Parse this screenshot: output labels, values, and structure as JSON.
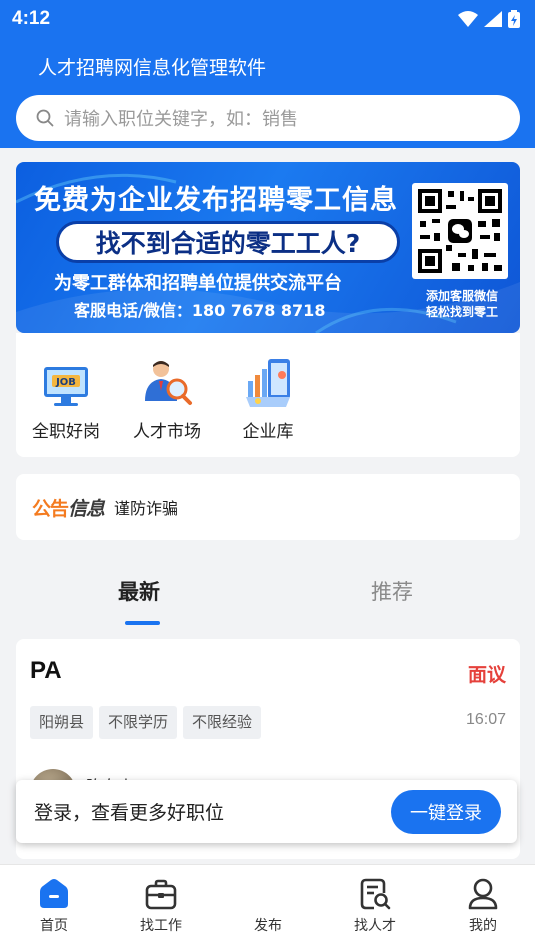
{
  "status": {
    "time": "4:12"
  },
  "header": {
    "title": "人才招聘网信息化管理软件"
  },
  "search": {
    "placeholder": "请输入职位关键字，如：销售"
  },
  "banner": {
    "line1": "免费为企业发布招聘零工信息",
    "line2": "找不到合适的零工工人?",
    "line3": "为零工群体和招聘单位提供交流平台",
    "line4": "客服电话/微信：180 7678 8718",
    "qr_caption_1": "添加客服微信",
    "qr_caption_2": "轻松找到零工"
  },
  "quick_links": [
    {
      "label": "全职好岗",
      "icon": "job-monitor-icon"
    },
    {
      "label": "人才市场",
      "icon": "talent-search-icon"
    },
    {
      "label": "企业库",
      "icon": "company-library-icon"
    }
  ],
  "notice": {
    "logo_part1": "公告",
    "logo_part2": "信息",
    "text": "谨防诈骗"
  },
  "tabs": {
    "latest": "最新",
    "recommend": "推荐"
  },
  "job": {
    "title": "PA",
    "salary": "面议",
    "tags": [
      "阳朔县",
      "不限学历",
      "不限经验"
    ],
    "time": "16:07",
    "poster": "陈女士"
  },
  "login_prompt": {
    "text": "登录，查看更多好职位",
    "button": "一键登录"
  },
  "tabbar": [
    {
      "label": "首页",
      "icon": "home-icon",
      "active": true
    },
    {
      "label": "找工作",
      "icon": "briefcase-icon",
      "active": false
    },
    {
      "label": "发布",
      "icon": "publish-icon",
      "active": false
    },
    {
      "label": "找人才",
      "icon": "find-talent-icon",
      "active": false
    },
    {
      "label": "我的",
      "icon": "profile-icon",
      "active": false
    }
  ],
  "colors": {
    "primary": "#1a73f0",
    "salary": "#e5413b",
    "notice_orange": "#f47b20"
  }
}
